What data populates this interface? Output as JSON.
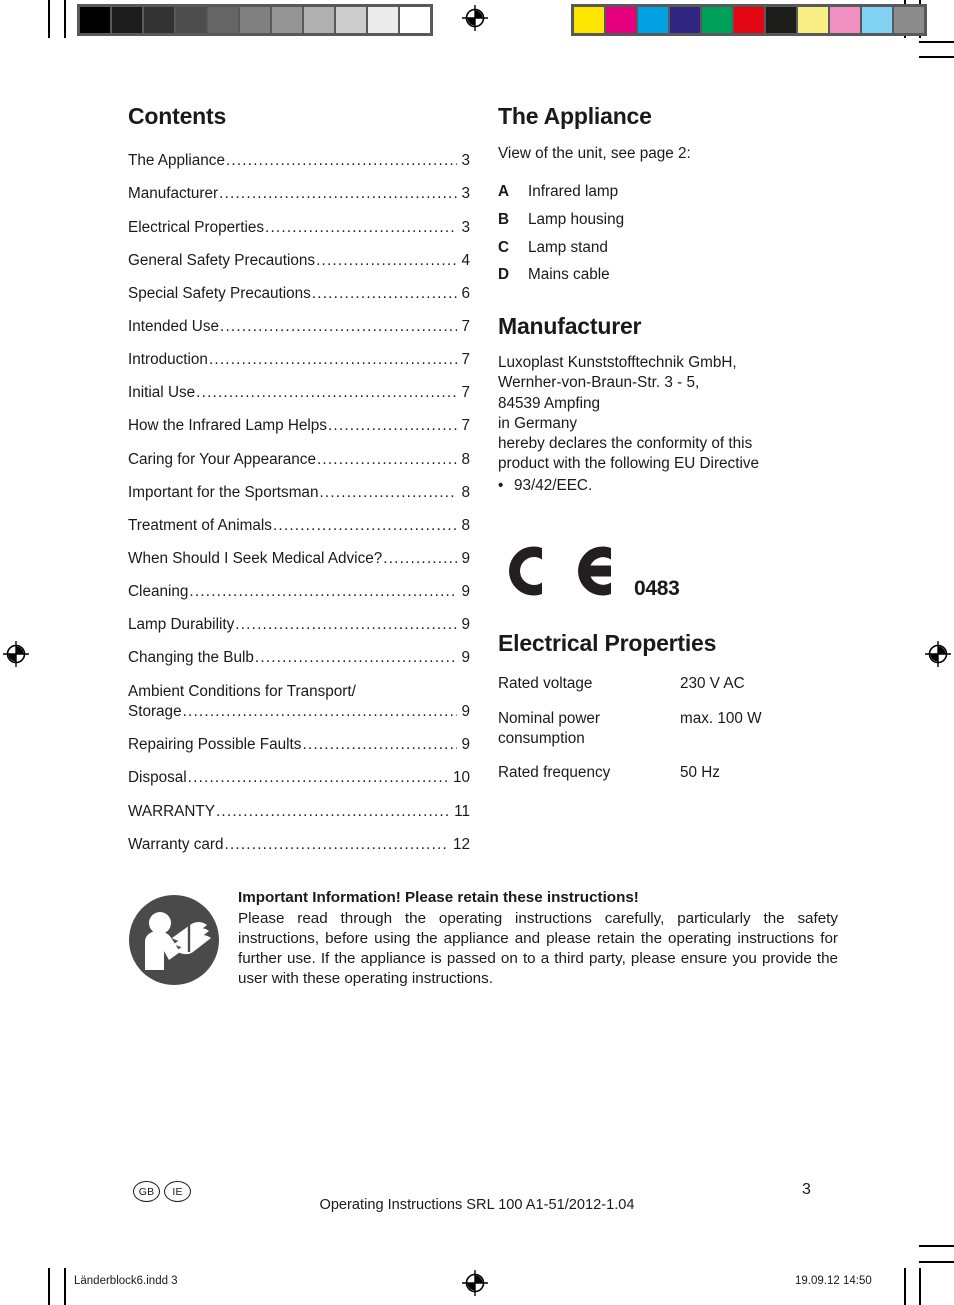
{
  "document": {
    "page_number": "3",
    "footer_center": "Operating Instructions SRL 100 A1-51/2012-1.04",
    "locale_badges": [
      "GB",
      "IE"
    ],
    "slug_left": "Länderblock6.indd   3",
    "slug_right": "19.09.12   14:50"
  },
  "calibration": {
    "grayscale": [
      "#000000",
      "#1c1c1c",
      "#333333",
      "#4d4d4d",
      "#666666",
      "#808080",
      "#949494",
      "#b0b0b0",
      "#cccccc",
      "#ebebeb",
      "#ffffff"
    ],
    "color": [
      "#ffe600",
      "#e6007e",
      "#00a0e3",
      "#312783",
      "#00a05a",
      "#e30613",
      "#1d1d1b",
      "#f9ef84",
      "#f18fc3",
      "#7fd2f4",
      "#8c8c8c"
    ]
  },
  "contents": {
    "title": "Contents",
    "entries": [
      {
        "label": "The Appliance ",
        "page": "3"
      },
      {
        "label": "Manufacturer ",
        "page": "3"
      },
      {
        "label": "Electrical Properties ",
        "page": "3"
      },
      {
        "label": "General Safety Precautions ",
        "page": "4"
      },
      {
        "label": "Special Safety Precautions ",
        "page": "6"
      },
      {
        "label": "Intended Use ",
        "page": "7"
      },
      {
        "label": "Introduction",
        "page": "7"
      },
      {
        "label": "Initial Use ",
        "page": "7"
      },
      {
        "label": "How the Infrared Lamp Helps ",
        "page": "7"
      },
      {
        "label": "Caring for Your Appearance ",
        "page": "8"
      },
      {
        "label": "Important for the Sportsman ",
        "page": "8"
      },
      {
        "label": "Treatment of Animals ",
        "page": "8"
      },
      {
        "label": "When Should I Seek Medical Advice? ",
        "page": "9"
      },
      {
        "label": "Cleaning ",
        "page": "9"
      },
      {
        "label": "Lamp Durability ",
        "page": "9"
      },
      {
        "label": "Changing the Bulb ",
        "page": "9"
      },
      {
        "label": "Ambient Conditions for Transport/",
        "label2": "Storage ",
        "page": "9",
        "wrap": true
      },
      {
        "label": "Repairing Possible Faults ",
        "page": "9"
      },
      {
        "label": "Disposal ",
        "page": "10"
      },
      {
        "label": "WARRANTY ",
        "page": "11"
      },
      {
        "label": "Warranty card",
        "page": "12"
      }
    ]
  },
  "appliance": {
    "title": "The Appliance",
    "intro": "View of the unit, see page 2:",
    "parts": [
      {
        "key": "A",
        "name": "Infrared lamp"
      },
      {
        "key": "B",
        "name": "Lamp housing"
      },
      {
        "key": "C",
        "name": "Lamp stand"
      },
      {
        "key": "D",
        "name": "Mains cable"
      }
    ]
  },
  "manufacturer": {
    "title": "Manufacturer",
    "address_lines": [
      "Luxoplast Kunststofftechnik GmbH,",
      "Wernher-von-Braun-Str. 3 - 5,",
      "84539 Ampfing",
      "in Germany",
      "hereby declares the conformity of this",
      "product with the following EU Directive"
    ],
    "directive_bullet": "•",
    "directive": "93/42/EEC.",
    "ce_notified_body": "0483"
  },
  "electrical": {
    "title": "Electrical Properties",
    "rows": [
      {
        "key": "Rated voltage",
        "value": "230 V AC"
      },
      {
        "key": "Nominal power consumption",
        "value": "max. 100 W"
      },
      {
        "key": "Rated frequency",
        "value": "50 Hz"
      }
    ]
  },
  "important_info": {
    "heading": "Important Information! Please retain these instructions!",
    "paragraph": "Please read through the operating instructions carefully, particularly the safety instructions, before using the appliance and please retain the operating instructions for further use. If the appliance is passed on to a third party, please ensure you provide the user with these operating instructions."
  }
}
